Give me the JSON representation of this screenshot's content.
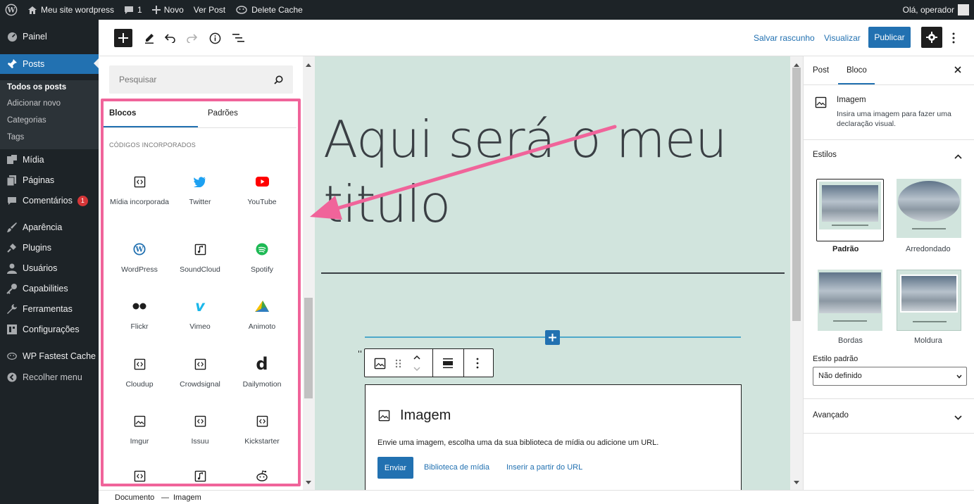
{
  "admin_bar": {
    "site_name": "Meu site wordpress",
    "comments_count": "1",
    "new_label": "Novo",
    "view_post_label": "Ver Post",
    "delete_cache_label": "Delete Cache",
    "greeting": "Olá, operador"
  },
  "admin_menu": {
    "items": [
      {
        "label": "Painel",
        "icon": "dashboard-icon"
      },
      {
        "label": "Posts",
        "icon": "pin-icon"
      },
      {
        "label": "Mídia",
        "icon": "media-icon"
      },
      {
        "label": "Páginas",
        "icon": "pages-icon"
      },
      {
        "label": "Comentários",
        "icon": "comment-icon",
        "badge": "1"
      },
      {
        "label": "Aparência",
        "icon": "brush-icon"
      },
      {
        "label": "Plugins",
        "icon": "plugin-icon"
      },
      {
        "label": "Usuários",
        "icon": "users-icon"
      },
      {
        "label": "Capabilities",
        "icon": "key-icon"
      },
      {
        "label": "Ferramentas",
        "icon": "wrench-icon"
      },
      {
        "label": "Configurações",
        "icon": "settings-icon"
      },
      {
        "label": "WP Fastest Cache",
        "icon": "cheetah-icon"
      },
      {
        "label": "Recolher menu",
        "icon": "collapse-icon"
      }
    ],
    "posts_submenu": [
      "Todos os posts",
      "Adicionar novo",
      "Categorias",
      "Tags"
    ]
  },
  "toolbar": {
    "save_draft": "Salvar rascunho",
    "preview": "Visualizar",
    "publish": "Publicar"
  },
  "inserter": {
    "search_placeholder": "Pesquisar",
    "tabs": [
      "Blocos",
      "Padrões"
    ],
    "category": "CÓDIGOS INCORPORADOS",
    "blocks": [
      {
        "label": "Mídia incorporada",
        "icon": "embed-icon"
      },
      {
        "label": "Twitter",
        "icon": "twitter-icon"
      },
      {
        "label": "YouTube",
        "icon": "youtube-icon"
      },
      {
        "label": "WordPress",
        "icon": "wordpress-icon"
      },
      {
        "label": "SoundCloud",
        "icon": "audio-icon"
      },
      {
        "label": "Spotify",
        "icon": "spotify-icon"
      },
      {
        "label": "Flickr",
        "icon": "flickr-icon"
      },
      {
        "label": "Vimeo",
        "icon": "vimeo-icon"
      },
      {
        "label": "Animoto",
        "icon": "animoto-icon"
      },
      {
        "label": "Cloudup",
        "icon": "embed-icon"
      },
      {
        "label": "Crowdsignal",
        "icon": "embed-icon"
      },
      {
        "label": "Dailymotion",
        "icon": "dailymotion-icon"
      },
      {
        "label": "Imgur",
        "icon": "image-icon"
      },
      {
        "label": "Issuu",
        "icon": "embed-icon"
      },
      {
        "label": "Kickstarter",
        "icon": "embed-icon"
      },
      {
        "label": "",
        "icon": "embed-icon"
      },
      {
        "label": "",
        "icon": "audio-icon"
      },
      {
        "label": "",
        "icon": "reddit-icon"
      }
    ]
  },
  "canvas": {
    "title": "Aqui será o meu titulo",
    "image_block": {
      "title": "Imagem",
      "instructions": "Envie uma imagem, escolha uma da sua biblioteca de mídia ou adicione um URL.",
      "upload": "Enviar",
      "media_library": "Biblioteca de mídia",
      "insert_url": "Inserir a partir do URL"
    }
  },
  "settings": {
    "tabs": [
      "Post",
      "Bloco"
    ],
    "block_name": "Imagem",
    "block_description": "Insira uma imagem para fazer uma declaração visual.",
    "styles_label": "Estilos",
    "styles": [
      "Padrão",
      "Arredondado",
      "Bordas",
      "Moldura"
    ],
    "default_style_label": "Estilo padrão",
    "default_style_value": "Não definido",
    "advanced_label": "Avançado"
  },
  "breadcrumb": [
    "Documento",
    "—",
    "Imagem"
  ],
  "colors": {
    "admin_dark": "#1d2327",
    "accent": "#2271b1",
    "canvas_bg": "#d1e4dd",
    "annotation": "#f0649a"
  }
}
